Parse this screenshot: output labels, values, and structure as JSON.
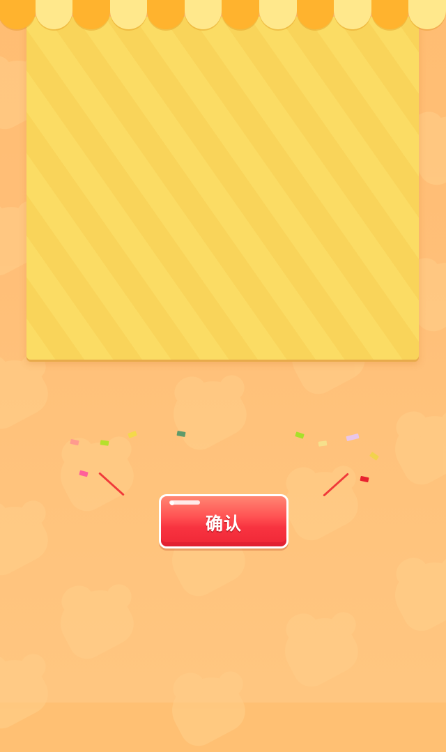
{
  "dialog": {
    "confirm_label": "确认"
  },
  "colors": {
    "background": "#ffbf78",
    "panel_stripe_light": "#fbdc64",
    "panel_stripe_dark": "#f9d45a",
    "awning_orange": "#ffb32e",
    "awning_cream": "#ffe88c",
    "button_red": "#f83340"
  },
  "icons": {
    "decor": [
      "cookie-icon",
      "confetti-icon",
      "streamer-icon"
    ]
  }
}
